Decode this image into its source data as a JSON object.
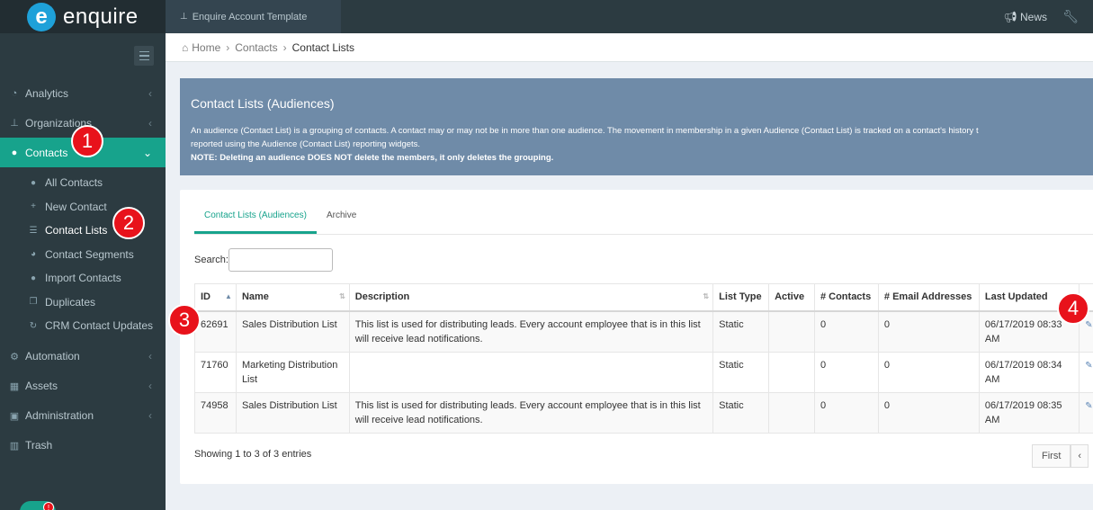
{
  "brand": {
    "logo_letter": "e",
    "name": "enquire"
  },
  "topbar": {
    "account": "Enquire Account Template",
    "news": "News",
    "news_icon": "megaphone-icon",
    "settings_icon": "wrench-icon"
  },
  "sidebar": {
    "menu": [
      {
        "label": "Analytics",
        "icon": "dashboard-icon"
      },
      {
        "label": "Organizations",
        "icon": "sitemap-icon"
      },
      {
        "label": "Contacts",
        "icon": "users-icon",
        "active": true
      }
    ],
    "submenu": [
      {
        "label": "All Contacts",
        "icon": "users-icon"
      },
      {
        "label": "New Contact",
        "icon": "plus-icon"
      },
      {
        "label": "Contact Lists",
        "icon": "list-icon"
      },
      {
        "label": "Contact Segments",
        "icon": "pie-icon"
      },
      {
        "label": "Import Contacts",
        "icon": "user-plus-icon"
      },
      {
        "label": "Duplicates",
        "icon": "copy-icon"
      },
      {
        "label": "CRM Contact Updates",
        "icon": "refresh-icon"
      }
    ],
    "menu_after": [
      {
        "label": "Automation",
        "icon": "cogs-icon"
      },
      {
        "label": "Assets",
        "icon": "th-icon"
      },
      {
        "label": "Administration",
        "icon": "lock-icon"
      },
      {
        "label": "Trash",
        "icon": "trash-icon"
      }
    ]
  },
  "breadcrumb": {
    "home": "Home",
    "contacts": "Contacts",
    "current": "Contact Lists"
  },
  "banner": {
    "title": "Contact Lists (Audiences)",
    "line1": "An audience (Contact List) is a grouping of contacts. A contact may or may not be in more than one audience. The movement in membership in a given Audience (Contact List) is tracked on a contact's history t",
    "line2": "reported using the Audience (Contact List) reporting widgets.",
    "note": "NOTE: Deleting an audience DOES NOT delete the members, it only deletes the grouping."
  },
  "tabs": {
    "active": "Contact Lists (Audiences)",
    "archive": "Archive"
  },
  "search": {
    "label": "Search:",
    "value": ""
  },
  "table": {
    "headers": [
      "ID",
      "Name",
      "Description",
      "List Type",
      "Active",
      "# Contacts",
      "# Email Addresses",
      "Last Updated"
    ],
    "rows": [
      {
        "id": "62691",
        "name": "Sales Distribution List",
        "description": "This list is used for distributing leads. Every account employee that is in this list will receive lead notifications.",
        "type": "Static",
        "active": "",
        "contacts": "0",
        "emails": "0",
        "updated": "06/17/2019 08:33 AM"
      },
      {
        "id": "71760",
        "name": "Marketing Distribution List",
        "description": "",
        "type": "Static",
        "active": "",
        "contacts": "0",
        "emails": "0",
        "updated": "06/17/2019 08:34 AM"
      },
      {
        "id": "74958",
        "name": "Sales Distribution List",
        "description": "This list is used for distributing leads. Every account employee that is in this list will receive lead notifications.",
        "type": "Static",
        "active": "",
        "contacts": "0",
        "emails": "0",
        "updated": "06/17/2019 08:35 AM"
      }
    ]
  },
  "footer": {
    "showing": "Showing 1 to 3 of 3 entries",
    "first": "First",
    "prev": "‹"
  },
  "annotations": [
    "1",
    "2",
    "3",
    "4"
  ],
  "colors": {
    "teal": "#17a38c",
    "sidebar": "#2c3b41",
    "banner": "#6f8ba8",
    "badge": "#e8121b"
  }
}
